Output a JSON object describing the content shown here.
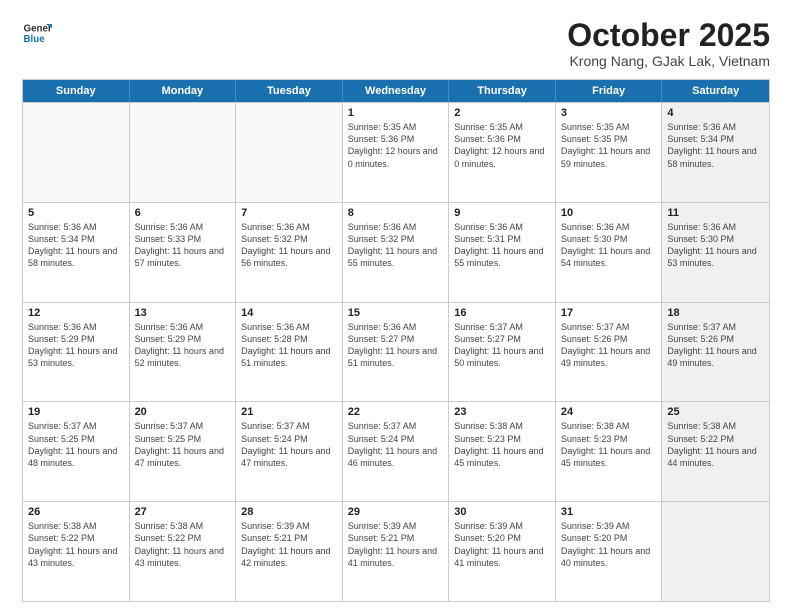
{
  "header": {
    "logo_general": "General",
    "logo_blue": "Blue",
    "month_title": "October 2025",
    "subtitle": "Krong Nang, GJak Lak, Vietnam"
  },
  "weekdays": [
    "Sunday",
    "Monday",
    "Tuesday",
    "Wednesday",
    "Thursday",
    "Friday",
    "Saturday"
  ],
  "rows": [
    [
      {
        "day": "",
        "sunrise": "",
        "sunset": "",
        "daylight": "",
        "shaded": false,
        "empty": true
      },
      {
        "day": "",
        "sunrise": "",
        "sunset": "",
        "daylight": "",
        "shaded": false,
        "empty": true
      },
      {
        "day": "",
        "sunrise": "",
        "sunset": "",
        "daylight": "",
        "shaded": false,
        "empty": true
      },
      {
        "day": "1",
        "sunrise": "Sunrise: 5:35 AM",
        "sunset": "Sunset: 5:36 PM",
        "daylight": "Daylight: 12 hours and 0 minutes.",
        "shaded": false,
        "empty": false
      },
      {
        "day": "2",
        "sunrise": "Sunrise: 5:35 AM",
        "sunset": "Sunset: 5:36 PM",
        "daylight": "Daylight: 12 hours and 0 minutes.",
        "shaded": false,
        "empty": false
      },
      {
        "day": "3",
        "sunrise": "Sunrise: 5:35 AM",
        "sunset": "Sunset: 5:35 PM",
        "daylight": "Daylight: 11 hours and 59 minutes.",
        "shaded": false,
        "empty": false
      },
      {
        "day": "4",
        "sunrise": "Sunrise: 5:36 AM",
        "sunset": "Sunset: 5:34 PM",
        "daylight": "Daylight: 11 hours and 58 minutes.",
        "shaded": true,
        "empty": false
      }
    ],
    [
      {
        "day": "5",
        "sunrise": "Sunrise: 5:36 AM",
        "sunset": "Sunset: 5:34 PM",
        "daylight": "Daylight: 11 hours and 58 minutes.",
        "shaded": false,
        "empty": false
      },
      {
        "day": "6",
        "sunrise": "Sunrise: 5:36 AM",
        "sunset": "Sunset: 5:33 PM",
        "daylight": "Daylight: 11 hours and 57 minutes.",
        "shaded": false,
        "empty": false
      },
      {
        "day": "7",
        "sunrise": "Sunrise: 5:36 AM",
        "sunset": "Sunset: 5:32 PM",
        "daylight": "Daylight: 11 hours and 56 minutes.",
        "shaded": false,
        "empty": false
      },
      {
        "day": "8",
        "sunrise": "Sunrise: 5:36 AM",
        "sunset": "Sunset: 5:32 PM",
        "daylight": "Daylight: 11 hours and 55 minutes.",
        "shaded": false,
        "empty": false
      },
      {
        "day": "9",
        "sunrise": "Sunrise: 5:36 AM",
        "sunset": "Sunset: 5:31 PM",
        "daylight": "Daylight: 11 hours and 55 minutes.",
        "shaded": false,
        "empty": false
      },
      {
        "day": "10",
        "sunrise": "Sunrise: 5:36 AM",
        "sunset": "Sunset: 5:30 PM",
        "daylight": "Daylight: 11 hours and 54 minutes.",
        "shaded": false,
        "empty": false
      },
      {
        "day": "11",
        "sunrise": "Sunrise: 5:36 AM",
        "sunset": "Sunset: 5:30 PM",
        "daylight": "Daylight: 11 hours and 53 minutes.",
        "shaded": true,
        "empty": false
      }
    ],
    [
      {
        "day": "12",
        "sunrise": "Sunrise: 5:36 AM",
        "sunset": "Sunset: 5:29 PM",
        "daylight": "Daylight: 11 hours and 53 minutes.",
        "shaded": false,
        "empty": false
      },
      {
        "day": "13",
        "sunrise": "Sunrise: 5:36 AM",
        "sunset": "Sunset: 5:29 PM",
        "daylight": "Daylight: 11 hours and 52 minutes.",
        "shaded": false,
        "empty": false
      },
      {
        "day": "14",
        "sunrise": "Sunrise: 5:36 AM",
        "sunset": "Sunset: 5:28 PM",
        "daylight": "Daylight: 11 hours and 51 minutes.",
        "shaded": false,
        "empty": false
      },
      {
        "day": "15",
        "sunrise": "Sunrise: 5:36 AM",
        "sunset": "Sunset: 5:27 PM",
        "daylight": "Daylight: 11 hours and 51 minutes.",
        "shaded": false,
        "empty": false
      },
      {
        "day": "16",
        "sunrise": "Sunrise: 5:37 AM",
        "sunset": "Sunset: 5:27 PM",
        "daylight": "Daylight: 11 hours and 50 minutes.",
        "shaded": false,
        "empty": false
      },
      {
        "day": "17",
        "sunrise": "Sunrise: 5:37 AM",
        "sunset": "Sunset: 5:26 PM",
        "daylight": "Daylight: 11 hours and 49 minutes.",
        "shaded": false,
        "empty": false
      },
      {
        "day": "18",
        "sunrise": "Sunrise: 5:37 AM",
        "sunset": "Sunset: 5:26 PM",
        "daylight": "Daylight: 11 hours and 49 minutes.",
        "shaded": true,
        "empty": false
      }
    ],
    [
      {
        "day": "19",
        "sunrise": "Sunrise: 5:37 AM",
        "sunset": "Sunset: 5:25 PM",
        "daylight": "Daylight: 11 hours and 48 minutes.",
        "shaded": false,
        "empty": false
      },
      {
        "day": "20",
        "sunrise": "Sunrise: 5:37 AM",
        "sunset": "Sunset: 5:25 PM",
        "daylight": "Daylight: 11 hours and 47 minutes.",
        "shaded": false,
        "empty": false
      },
      {
        "day": "21",
        "sunrise": "Sunrise: 5:37 AM",
        "sunset": "Sunset: 5:24 PM",
        "daylight": "Daylight: 11 hours and 47 minutes.",
        "shaded": false,
        "empty": false
      },
      {
        "day": "22",
        "sunrise": "Sunrise: 5:37 AM",
        "sunset": "Sunset: 5:24 PM",
        "daylight": "Daylight: 11 hours and 46 minutes.",
        "shaded": false,
        "empty": false
      },
      {
        "day": "23",
        "sunrise": "Sunrise: 5:38 AM",
        "sunset": "Sunset: 5:23 PM",
        "daylight": "Daylight: 11 hours and 45 minutes.",
        "shaded": false,
        "empty": false
      },
      {
        "day": "24",
        "sunrise": "Sunrise: 5:38 AM",
        "sunset": "Sunset: 5:23 PM",
        "daylight": "Daylight: 11 hours and 45 minutes.",
        "shaded": false,
        "empty": false
      },
      {
        "day": "25",
        "sunrise": "Sunrise: 5:38 AM",
        "sunset": "Sunset: 5:22 PM",
        "daylight": "Daylight: 11 hours and 44 minutes.",
        "shaded": true,
        "empty": false
      }
    ],
    [
      {
        "day": "26",
        "sunrise": "Sunrise: 5:38 AM",
        "sunset": "Sunset: 5:22 PM",
        "daylight": "Daylight: 11 hours and 43 minutes.",
        "shaded": false,
        "empty": false
      },
      {
        "day": "27",
        "sunrise": "Sunrise: 5:38 AM",
        "sunset": "Sunset: 5:22 PM",
        "daylight": "Daylight: 11 hours and 43 minutes.",
        "shaded": false,
        "empty": false
      },
      {
        "day": "28",
        "sunrise": "Sunrise: 5:39 AM",
        "sunset": "Sunset: 5:21 PM",
        "daylight": "Daylight: 11 hours and 42 minutes.",
        "shaded": false,
        "empty": false
      },
      {
        "day": "29",
        "sunrise": "Sunrise: 5:39 AM",
        "sunset": "Sunset: 5:21 PM",
        "daylight": "Daylight: 11 hours and 41 minutes.",
        "shaded": false,
        "empty": false
      },
      {
        "day": "30",
        "sunrise": "Sunrise: 5:39 AM",
        "sunset": "Sunset: 5:20 PM",
        "daylight": "Daylight: 11 hours and 41 minutes.",
        "shaded": false,
        "empty": false
      },
      {
        "day": "31",
        "sunrise": "Sunrise: 5:39 AM",
        "sunset": "Sunset: 5:20 PM",
        "daylight": "Daylight: 11 hours and 40 minutes.",
        "shaded": false,
        "empty": false
      },
      {
        "day": "",
        "sunrise": "",
        "sunset": "",
        "daylight": "",
        "shaded": true,
        "empty": true
      }
    ]
  ]
}
